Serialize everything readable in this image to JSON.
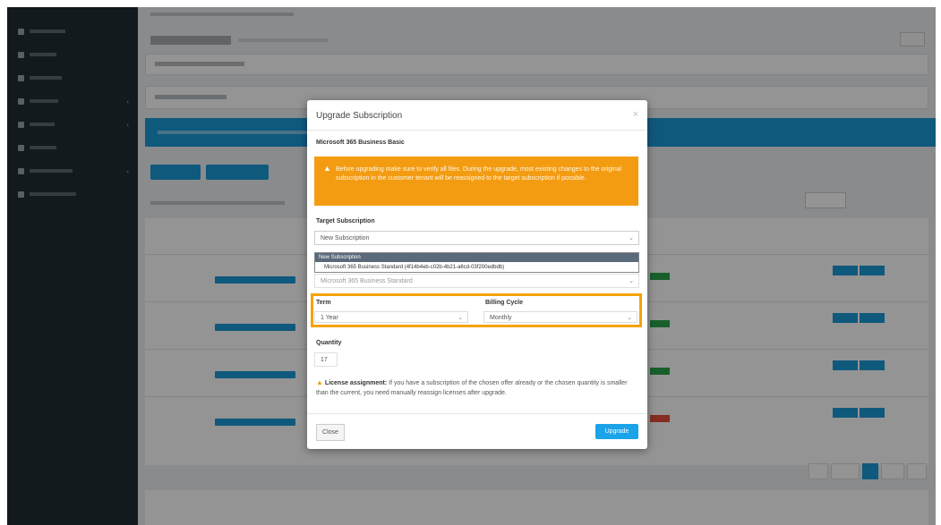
{
  "modal": {
    "title": "Upgrade Subscription",
    "close_glyph": "×",
    "product_name": "Microsoft 365 Business Basic",
    "warning_text": "Before upgrading make sure to verify all files. During the upgrade, most existing changes to the original subscription in the customer tenant will be reassigned to the target subscription if possible.",
    "target_label": "Target Subscription",
    "target_value": "New Subscription",
    "dropdown_options": [
      "New Subscription",
      "Microsoft 365 Business Standard (4f14b4eb-c02b-4b21-a6cd-03f200edbdb)"
    ],
    "hidden_row_value": "Microsoft 365 Business Standard",
    "term_label": "Term",
    "term_value": "1 Year",
    "billing_label": "Billing Cycle",
    "billing_value": "Monthly",
    "quantity_label": "Quantity",
    "quantity_value": "17",
    "license_bold": "License assignment:",
    "license_text": "If you have a subscription of the chosen offer already or the chosen quantity is smaller than the current, you need manually reassign licenses after upgrade.",
    "close_label": "Close",
    "upgrade_label": "Upgrade"
  },
  "highlight_color": "#f6a300",
  "accent_color": "#1a9ad7",
  "warning_color": "#f39c12"
}
